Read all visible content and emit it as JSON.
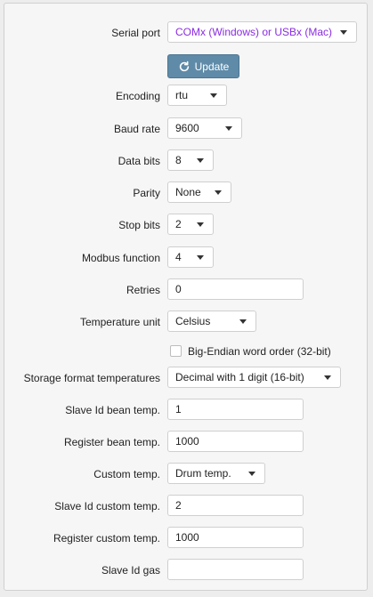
{
  "serial_port": {
    "label": "Serial port",
    "value": "COMx (Windows) or USBx (Mac)",
    "value_color": "#8a2be2"
  },
  "update_button": {
    "label": "Update",
    "icon": "refresh-icon",
    "color": "#5f8ba8"
  },
  "encoding": {
    "label": "Encoding",
    "value": "rtu"
  },
  "baud_rate": {
    "label": "Baud rate",
    "value": "9600"
  },
  "data_bits": {
    "label": "Data bits",
    "value": "8"
  },
  "parity": {
    "label": "Parity",
    "value": "None"
  },
  "stop_bits": {
    "label": "Stop bits",
    "value": "2"
  },
  "modbus_function": {
    "label": "Modbus function",
    "value": "4"
  },
  "retries": {
    "label": "Retries",
    "value": "0"
  },
  "temperature_unit": {
    "label": "Temperature unit",
    "value": "Celsius"
  },
  "big_endian": {
    "label": "Big-Endian word order (32-bit)",
    "checked": false
  },
  "storage_format": {
    "label": "Storage format temperatures",
    "value": "Decimal with 1 digit (16-bit)"
  },
  "slave_id_bean": {
    "label": "Slave Id bean temp.",
    "value": "1"
  },
  "register_bean": {
    "label": "Register bean temp.",
    "value": "1000"
  },
  "custom_temp": {
    "label": "Custom temp.",
    "value": "Drum temp."
  },
  "slave_id_custom": {
    "label": "Slave Id custom temp.",
    "value": "2"
  },
  "register_custom": {
    "label": "Register custom temp.",
    "value": "1000"
  },
  "slave_id_gas": {
    "label": "Slave Id gas",
    "value": ""
  }
}
